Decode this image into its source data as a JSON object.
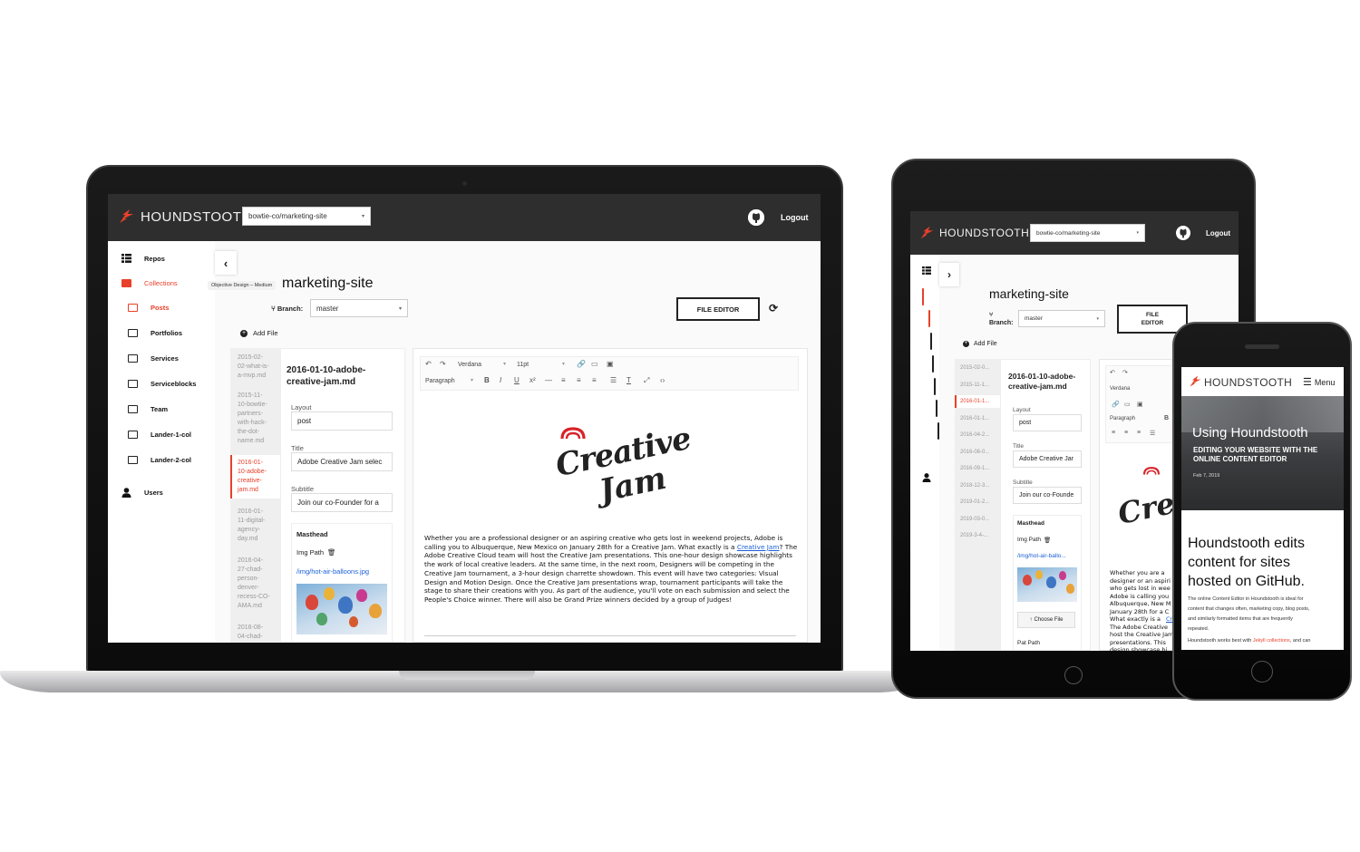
{
  "laptop": {
    "brand": "HOUNDSTOOTH",
    "repo_select": "bowtie-co/marketing-site",
    "logout": "Logout",
    "sidebar": [
      {
        "label": "Repos",
        "icon": "grid-icon"
      },
      {
        "label": "Collections",
        "icon": "folder-filled-icon",
        "active": true
      },
      {
        "label": "Posts",
        "icon": "folder-open-icon",
        "active": true
      },
      {
        "label": "Portfolios",
        "icon": "folder-icon"
      },
      {
        "label": "Services",
        "icon": "folder-icon"
      },
      {
        "label": "Serviceblocks",
        "icon": "folder-icon"
      },
      {
        "label": "Team",
        "icon": "folder-icon"
      },
      {
        "label": "Lander-1-col",
        "icon": "folder-icon"
      },
      {
        "label": "Lander-2-col",
        "icon": "folder-icon"
      },
      {
        "label": "Users",
        "icon": "user-icon"
      }
    ],
    "tooltip": "Objective Design – Medium",
    "repo_title": "marketing-site",
    "branch_label": "Branch:",
    "branch_value": "master",
    "file_editor_btn": "FILE EDITOR",
    "add_file": "Add File",
    "files": [
      "2015-02-02-what-is-a-mvp.md",
      "2015-11-10-bowtie-partners-with-hack-the-dot-name.md",
      "2016-01-10-adobe-creative-jam.md",
      "2016-01-11-digital-agency-day.md",
      "2016-04-27-chad-person-denver-recess-CO-AMA.md",
      "2016-08-04-chad-"
    ],
    "file_lines": [
      [
        "2015-02-",
        "02-what-is-",
        "a-mvp.md"
      ],
      [
        "2015-11-",
        "10-bowtie-",
        "partners-",
        "with-hack-",
        "the-dot-",
        "name.md"
      ],
      [
        "2016-01-",
        "10-adobe-",
        "creative-",
        "jam.md"
      ],
      [
        "2016-01-",
        "11-digital-",
        "agency-",
        "day.md"
      ],
      [
        "2016-04-",
        "27-chad-",
        "person-",
        "denver-",
        "recess-CO-",
        "AMA.md"
      ],
      [
        "2016-08-",
        "04-chad-"
      ]
    ],
    "doc_title_1": "2016-01-10-adobe-",
    "doc_title_2": "creative-jam.md",
    "layout_label": "Layout",
    "layout_value": "post",
    "title_label": "Title",
    "title_value": "Adobe Creative Jam selec",
    "subtitle_label": "Subtitle",
    "subtitle_value": "Join our co-Founder for a",
    "masthead_label": "Masthead",
    "img_path_label": "Img Path",
    "img_path_value": "/img/hot-air-balloons.jpg",
    "editor_font": "Verdana",
    "editor_size": "11pt",
    "editor_block": "Paragraph",
    "logo_text_1": "Creative",
    "logo_text_2": "Jam",
    "body_pre": "Whether you are a professional designer or an aspiring creative who gets lost in weekend projects, Adobe is calling you to Albuquerque, New Mexico on January 28th for a Creative Jam. What exactly is a ",
    "body_link": "Creative Jam",
    "body_post": "? The Adobe Creative Cloud team will host the Creative Jam presentations. This one-hour design showcase highlights the work of local creative leaders. At the same time, in the next room, Designers will be competing in the Creative Jam tournament, a 3-hour design charrette showdown. This event will have two categories: Visual Design and Motion Design. Once the Creative Jam presentations wrap, tournament participants will take the stage to share their creations with you. As part of the audience, you'll vote on each submission and select the People's Choice winner. There will also be Grand Prize winners decided by a group of Judges!"
  },
  "tablet": {
    "brand": "HOUNDSTOOTH",
    "repo_select": "bowtie-co/marketing-site",
    "logout": "Logout",
    "repo_title": "marketing-site",
    "branch_label": "Branch:",
    "branch_value": "master",
    "file_editor_btn_1": "FILE",
    "file_editor_btn_2": "EDITOR",
    "add_file": "Add File",
    "files": [
      "2015-02-0...",
      "2015-11-1...",
      "2016-01-1...",
      "2016-01-1...",
      "2016-04-2...",
      "2016-08-0...",
      "2016-09-1...",
      "2018-12-3...",
      "2019-01-2...",
      "2019-03-0...",
      "2019-3-4-..."
    ],
    "doc_title_1": "2016-01-10-adobe-",
    "doc_title_2": "creative-jam.md",
    "layout_label": "Layout",
    "layout_value": "post",
    "title_label": "Title",
    "title_value": "Adobe Creative Jar",
    "subtitle_label": "Subtitle",
    "subtitle_value": "Join our co-Founde",
    "masthead_label": "Masthead",
    "img_path_label": "Img Path",
    "img_path_value": "/img/hot-air-ballo...",
    "choose_file": "Choose File",
    "pat_path": "Pat Path",
    "editor_font": "Verdana",
    "editor_block": "Paragraph",
    "body_lines": [
      "Whether you are a",
      "designer or an aspiri",
      "who gets lost in wee",
      "Adobe is calling you",
      "Albuquerque, New M",
      "January 28th for a C",
      "What exactly is a",
      "The Adobe Creative",
      "host the Creative Jam",
      "presentations. This",
      "design showcase hi"
    ],
    "body_link": "Cre"
  },
  "phone": {
    "brand": "HOUNDSTOOTH",
    "menu": "Menu",
    "hero_title": "Using Houndstooth",
    "hero_sub_1": "EDITING YOUR WEBSITE WITH THE",
    "hero_sub_2": "ONLINE CONTENT EDITOR",
    "hero_date": "Feb 7, 2019",
    "headline_1": "Houndstooth edits",
    "headline_2": "content for sites",
    "headline_3": "hosted on GitHub.",
    "para_lines": [
      "The online Content Editor in Houndstooth is ideal for",
      "content that changes often, marketing copy, blog posts,",
      "and similarly formatted items that are frequently",
      "repeated."
    ],
    "para2_pre": "Houndstooth works best with ",
    "para2_link": "Jekyll collections",
    "para2_post": ", and can"
  },
  "colors": {
    "accent": "#e8402a",
    "header": "#2e2e2e",
    "link": "#1a5fd6"
  }
}
